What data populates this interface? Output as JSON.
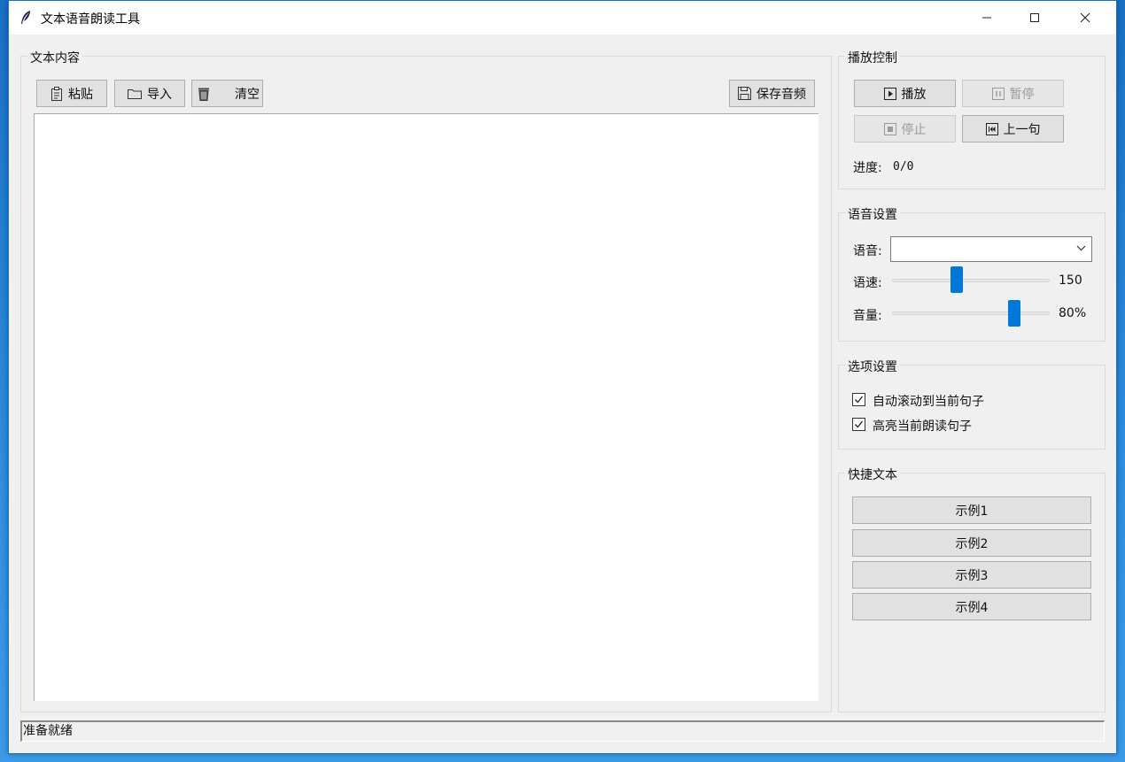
{
  "window": {
    "title": "文本语音朗读工具"
  },
  "text_panel": {
    "legend": "文本内容",
    "toolbar": {
      "paste_label": "粘贴",
      "import_label": "导入",
      "clear_label": "清空",
      "save_audio_label": "保存音频"
    },
    "text_content": ""
  },
  "playback": {
    "legend": "播放控制",
    "play_label": "播放",
    "pause_label": "暂停",
    "stop_label": "停止",
    "prev_label": "上一句",
    "progress_label": "进度:",
    "progress_value": "0/0"
  },
  "voice_settings": {
    "legend": "语音设置",
    "voice_label": "语音:",
    "voice_selected": "",
    "rate_label": "语速:",
    "rate_value": "150",
    "rate_position": 0.4,
    "volume_label": "音量:",
    "volume_value": "80%",
    "volume_position": 0.8
  },
  "options": {
    "legend": "选项设置",
    "auto_scroll_label": "自动滚动到当前句子",
    "auto_scroll_checked": true,
    "highlight_label": "高亮当前朗读句子",
    "highlight_checked": true
  },
  "quick_text": {
    "legend": "快捷文本",
    "examples": [
      "示例1",
      "示例2",
      "示例3",
      "示例4"
    ]
  },
  "status": {
    "text": "准备就绪"
  },
  "colors": {
    "accent": "#0078d7",
    "button_bg": "#e1e1e1",
    "disabled_text": "#9a9a9a"
  }
}
